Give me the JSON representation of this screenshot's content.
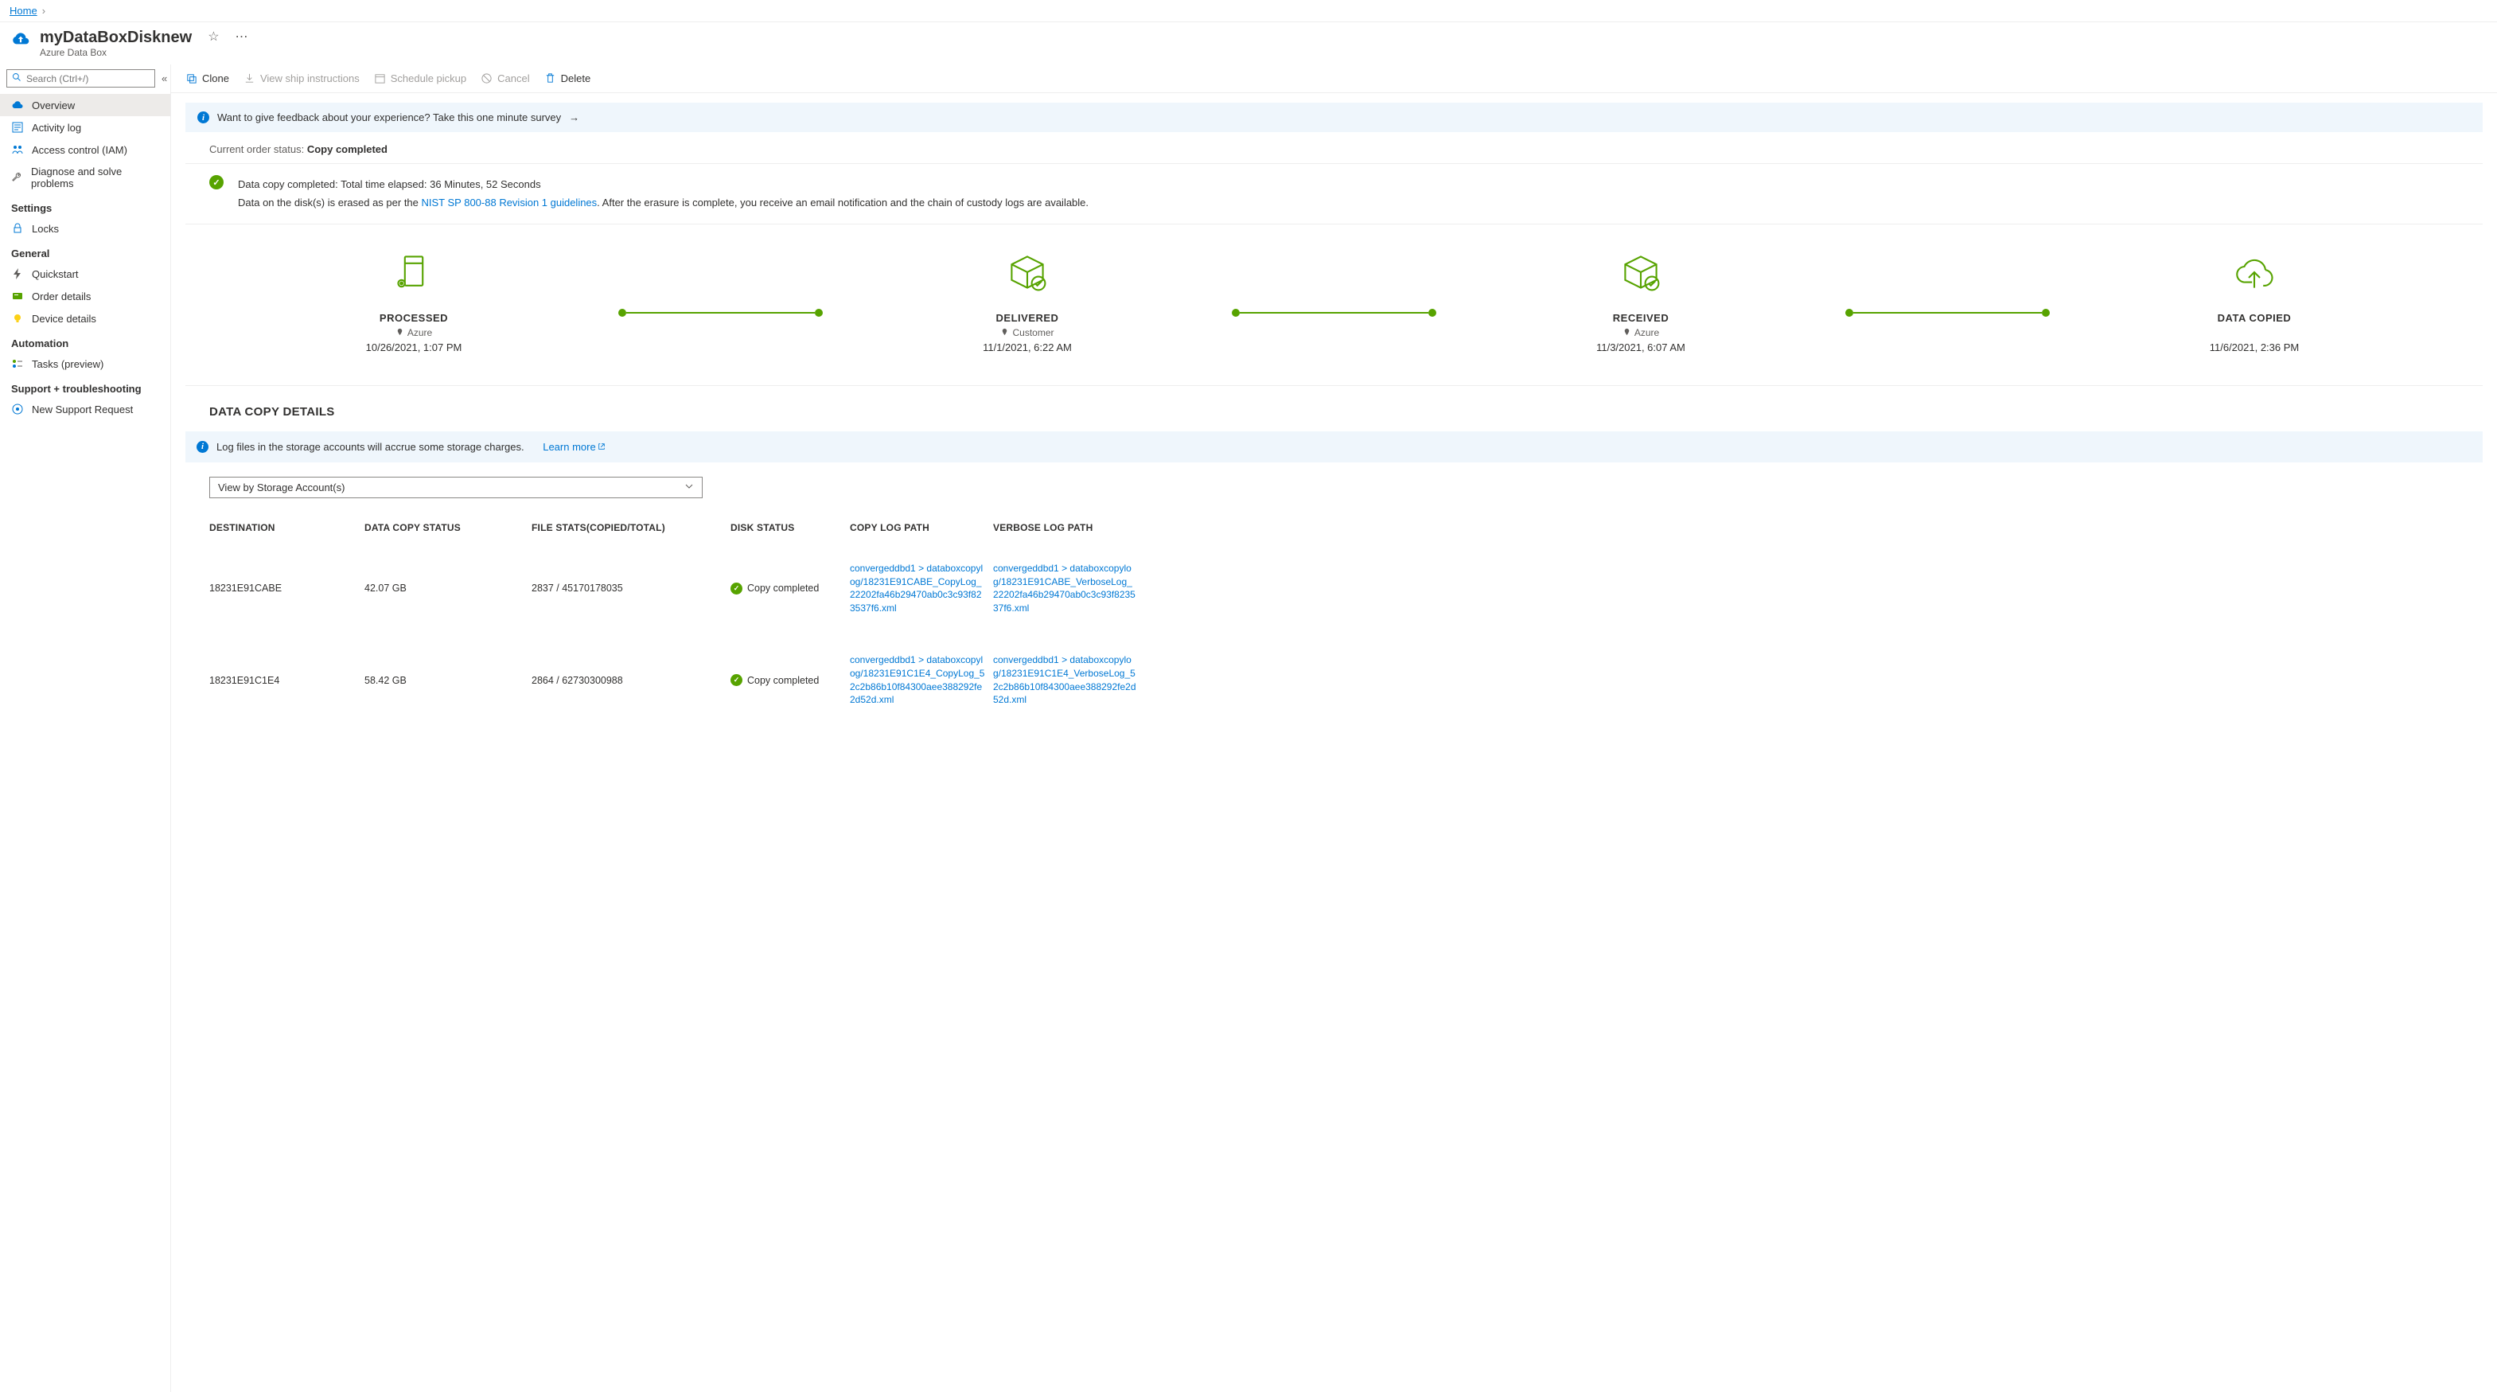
{
  "breadcrumb": {
    "home": "Home"
  },
  "header": {
    "title": "myDataBoxDisknew",
    "subtitle": "Azure Data Box"
  },
  "sidebar": {
    "search_placeholder": "Search (Ctrl+/)",
    "items": {
      "overview": "Overview",
      "activity": "Activity log",
      "iam": "Access control (IAM)",
      "diagnose": "Diagnose and solve problems"
    },
    "groups": {
      "settings": "Settings",
      "general": "General",
      "automation": "Automation",
      "support": "Support + troubleshooting"
    },
    "settings_items": {
      "locks": "Locks"
    },
    "general_items": {
      "quickstart": "Quickstart",
      "orderdetails": "Order details",
      "devicedetails": "Device details"
    },
    "automation_items": {
      "tasks": "Tasks (preview)"
    },
    "support_items": {
      "newsupport": "New Support Request"
    }
  },
  "toolbar": {
    "clone": "Clone",
    "ship": "View ship instructions",
    "pickup": "Schedule pickup",
    "cancel": "Cancel",
    "delete": "Delete"
  },
  "feedback": {
    "text": "Want to give feedback about your experience? Take this one minute survey"
  },
  "status": {
    "label": "Current order status: ",
    "value": "Copy completed"
  },
  "copymsg": {
    "line1": "Data copy completed: Total time elapsed: 36 Minutes, 52 Seconds",
    "line2a": "Data on the disk(s) is erased as per the ",
    "line2link": "NIST SP 800-88 Revision 1 guidelines",
    "line2b": ". After the erasure is complete, you receive an email notification and the chain of custody logs are available."
  },
  "stages": {
    "processed": {
      "title": "PROCESSED",
      "sub": "Azure",
      "date": "10/26/2021, 1:07 PM"
    },
    "delivered": {
      "title": "DELIVERED",
      "sub": "Customer",
      "date": "11/1/2021, 6:22 AM"
    },
    "received": {
      "title": "RECEIVED",
      "sub": "Azure",
      "date": "11/3/2021, 6:07 AM"
    },
    "copied": {
      "title": "DATA COPIED",
      "date": "11/6/2021, 2:36 PM"
    }
  },
  "details": {
    "title": "DATA COPY DETAILS",
    "banner": "Log files in the storage accounts will accrue some storage charges.",
    "learnmore": "Learn more",
    "viewby": "View by Storage Account(s)",
    "headers": {
      "dest": "DESTINATION",
      "status": "DATA COPY STATUS",
      "stats": "FILE STATS(COPIED/TOTAL)",
      "disk": "DISK STATUS",
      "copylog": "COPY LOG PATH",
      "verbose": "VERBOSE LOG PATH"
    },
    "rows": [
      {
        "dest": "18231E91CABE",
        "status": "42.07 GB",
        "stats": "2837 / 45170178035",
        "disk": "Copy completed",
        "copylog": "convergeddbd1 > databoxcopylog/18231E91CABE_CopyLog_22202fa46b29470ab0c3c93f823537f6.xml",
        "verbose": "convergeddbd1 > databoxcopylog/18231E91CABE_VerboseLog_22202fa46b29470ab0c3c93f823537f6.xml"
      },
      {
        "dest": "18231E91C1E4",
        "status": "58.42 GB",
        "stats": "2864 / 62730300988",
        "disk": "Copy completed",
        "copylog": "convergeddbd1 > databoxcopylog/18231E91C1E4_CopyLog_52c2b86b10f84300aee388292fe2d52d.xml",
        "verbose": "convergeddbd1 > databoxcopylog/18231E91C1E4_VerboseLog_52c2b86b10f84300aee388292fe2d52d.xml"
      }
    ]
  }
}
